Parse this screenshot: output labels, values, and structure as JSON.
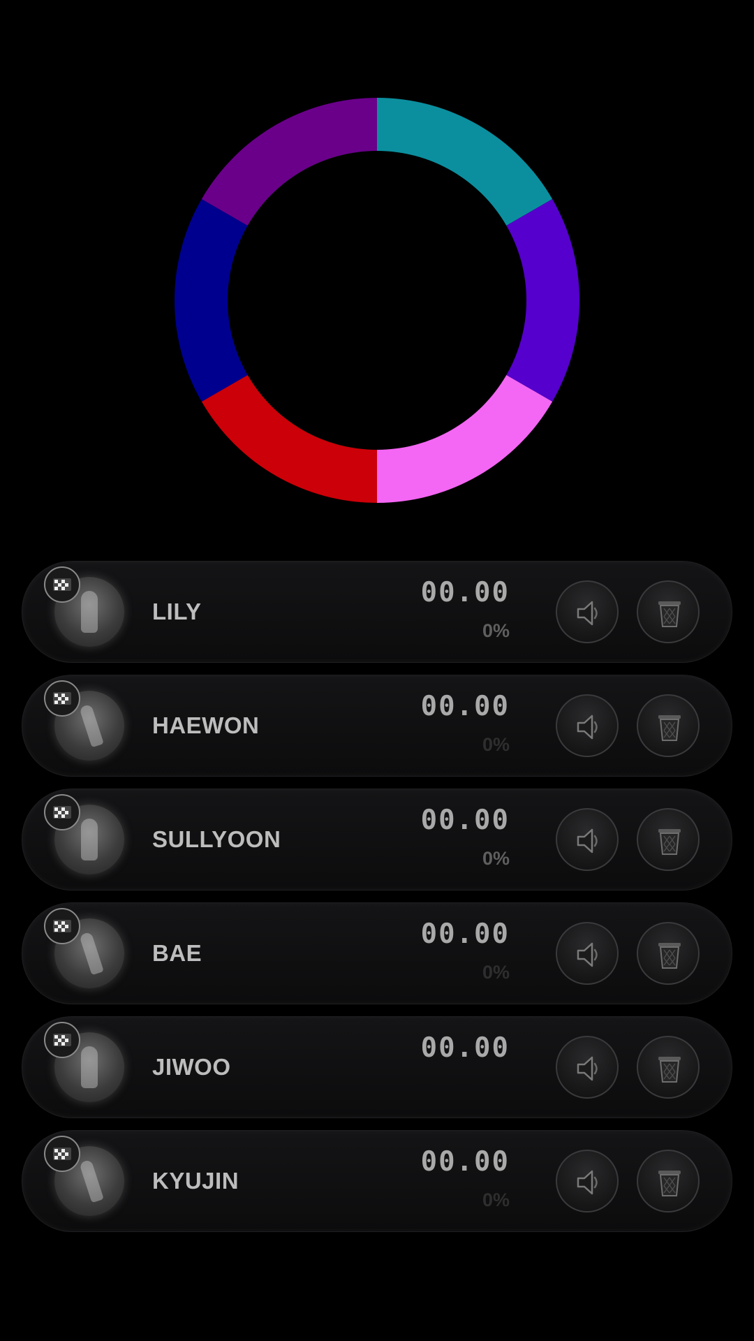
{
  "ring": {
    "segments": [
      {
        "color": "#0b8f9f",
        "value": 1
      },
      {
        "color": "#5500cc",
        "value": 1
      },
      {
        "color": "#f466f4",
        "value": 1
      },
      {
        "color": "#cc0008",
        "value": 1
      },
      {
        "color": "#00008f",
        "value": 1
      },
      {
        "color": "#6a008a",
        "value": 1
      }
    ]
  },
  "members": [
    {
      "name": "LILY",
      "time": "00.00",
      "percent": "0%",
      "percent_dim": false
    },
    {
      "name": "HAEWON",
      "time": "00.00",
      "percent": "0%",
      "percent_dim": true
    },
    {
      "name": "SULLYOON",
      "time": "00.00",
      "percent": "0%",
      "percent_dim": false
    },
    {
      "name": "BAE",
      "time": "00.00",
      "percent": "0%",
      "percent_dim": true
    },
    {
      "name": "JIWOO",
      "time": "00.00",
      "percent": "",
      "percent_dim": true
    },
    {
      "name": "KYUJIN",
      "time": "00.00",
      "percent": "0%",
      "percent_dim": true
    }
  ],
  "icons": {
    "speaker": "speaker-icon",
    "trash": "trash-icon",
    "badge": "checkered-flag-icon"
  }
}
